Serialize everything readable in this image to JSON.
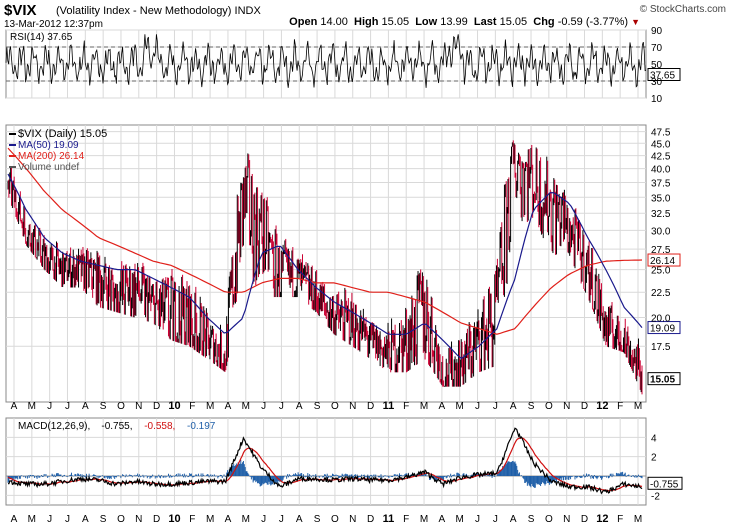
{
  "header": {
    "symbol": "$VIX",
    "description": "(Volatility Index - New Methodology)",
    "exchange": "INDX",
    "datetime": "13-Mar-2012 12:37pm",
    "open_label": "Open",
    "open": "14.00",
    "high_label": "High",
    "high": "15.05",
    "low_label": "Low",
    "low": "13.99",
    "last_label": "Last",
    "last": "15.05",
    "chg_label": "Chg",
    "chg": "-0.59 (-3.77%)",
    "brand": "© StockCharts.com"
  },
  "chart_data": [
    {
      "type": "line",
      "title": "RSI(14) 37.65",
      "series": [
        {
          "name": "RSI(14)",
          "last": 37.65
        }
      ],
      "y_ticks": [
        "90",
        "70",
        "50",
        "30",
        "10"
      ],
      "ylim": [
        10,
        90
      ],
      "reference_lines": [
        70,
        30
      ],
      "last_value_label": "37.65"
    },
    {
      "type": "bar",
      "title": "$VIX (Daily) 15.05",
      "legend": [
        "$VIX (Daily) 15.05",
        "MA(50) 19.09",
        "MA(200) 26.14",
        "Volume undef"
      ],
      "y_ticks": [
        "47.5",
        "45.0",
        "42.5",
        "40.0",
        "37.5",
        "35.0",
        "32.5",
        "30.0",
        "27.5",
        "25.0",
        "22.5",
        "20.0",
        "17.5"
      ],
      "y_scale": "log",
      "ylim": [
        13.5,
        49
      ],
      "x_ticks": [
        "A",
        "M",
        "J",
        "J",
        "A",
        "S",
        "O",
        "N",
        "D",
        "10",
        "F",
        "M",
        "A",
        "M",
        "J",
        "J",
        "A",
        "S",
        "O",
        "N",
        "D",
        "11",
        "F",
        "M",
        "A",
        "M",
        "J",
        "J",
        "A",
        "S",
        "O",
        "N",
        "D",
        "12",
        "F",
        "M"
      ],
      "last_label": "15.05",
      "ma50_label": "19.09",
      "ma200_label": "26.14",
      "monthly": {
        "x": [
          "2009-04",
          "2009-05",
          "2009-06",
          "2009-07",
          "2009-08",
          "2009-09",
          "2009-10",
          "2009-11",
          "2009-12",
          "2010-01",
          "2010-02",
          "2010-03",
          "2010-04",
          "2010-05",
          "2010-06",
          "2010-07",
          "2010-08",
          "2010-09",
          "2010-10",
          "2010-11",
          "2010-12",
          "2011-01",
          "2011-02",
          "2011-03",
          "2011-04",
          "2011-05",
          "2011-06",
          "2011-07",
          "2011-08",
          "2011-09",
          "2011-10",
          "2011-11",
          "2011-12",
          "2012-01",
          "2012-02",
          "2012-03"
        ],
        "high": [
          44,
          35,
          32,
          28,
          28,
          27.5,
          30,
          28,
          26,
          29,
          28,
          21,
          20,
          47.5,
          38,
          33,
          29,
          26.5,
          24,
          23,
          20,
          19.5,
          22,
          31,
          18,
          19,
          22,
          30,
          48,
          46.5,
          45,
          37,
          31,
          23,
          21,
          17.5
        ],
        "low": [
          35,
          28,
          25,
          23,
          23,
          21,
          20.5,
          20,
          19.5,
          18,
          17.5,
          16.5,
          15.5,
          22,
          22,
          22,
          22,
          20.5,
          18.5,
          17.5,
          16.5,
          15.5,
          15.5,
          16.5,
          14.5,
          14.5,
          15.5,
          16,
          21,
          30,
          27,
          26,
          22,
          17.5,
          17,
          13.99
        ],
        "close": [
          37,
          30,
          26,
          25,
          25,
          24,
          22,
          23,
          21,
          20,
          19.5,
          18,
          16.5,
          34,
          30,
          24,
          24,
          22,
          20,
          19.5,
          18,
          17,
          18,
          21,
          15,
          16,
          18,
          20,
          42,
          38,
          34,
          30,
          25,
          19,
          18,
          15.05
        ],
        "ma50": [
          39,
          33,
          29,
          27,
          26,
          25.5,
          25,
          25,
          24,
          23,
          22,
          20,
          18.5,
          20,
          27,
          28,
          25,
          23,
          21.5,
          20.5,
          19.5,
          18.5,
          18.5,
          19.5,
          18,
          16.5,
          17.5,
          19,
          24,
          33,
          36,
          34,
          29,
          25,
          21,
          19.09
        ],
        "ma200": [
          44,
          40,
          36,
          33,
          31,
          29,
          28,
          27,
          26,
          25.5,
          24.5,
          23.5,
          22.5,
          22.5,
          23.5,
          24,
          24,
          23.5,
          23.5,
          23,
          22.5,
          22.5,
          22,
          21.5,
          20.5,
          19.5,
          19,
          18.5,
          19,
          21,
          23,
          24.5,
          25.5,
          26,
          26.1,
          26.14
        ]
      }
    },
    {
      "type": "line",
      "title": "MACD(12,26,9) -0.755, -0.558, -0.197",
      "legend": [
        "MACD(12,26,9)",
        "-0.755",
        "-0.558",
        "-0.197"
      ],
      "y_ticks": [
        "4",
        "2",
        "-2"
      ],
      "ylim": [
        -3,
        6
      ],
      "last_value_label": "-0.755",
      "x_ticks": [
        "A",
        "M",
        "J",
        "J",
        "A",
        "S",
        "O",
        "N",
        "D",
        "10",
        "F",
        "M",
        "A",
        "M",
        "J",
        "J",
        "A",
        "S",
        "O",
        "N",
        "D",
        "11",
        "F",
        "M",
        "A",
        "M",
        "J",
        "J",
        "A",
        "S",
        "O",
        "N",
        "D",
        "12",
        "F",
        "M"
      ]
    }
  ],
  "colors": {
    "price_up": "#000000",
    "price_down": "#cc0033",
    "ma50": "#1a1a8c",
    "ma200": "#e0201a",
    "macd_line": "#000000",
    "signal_line": "#d01010",
    "histogram": "#1f5fa8",
    "grid": "#d9d9d9"
  }
}
